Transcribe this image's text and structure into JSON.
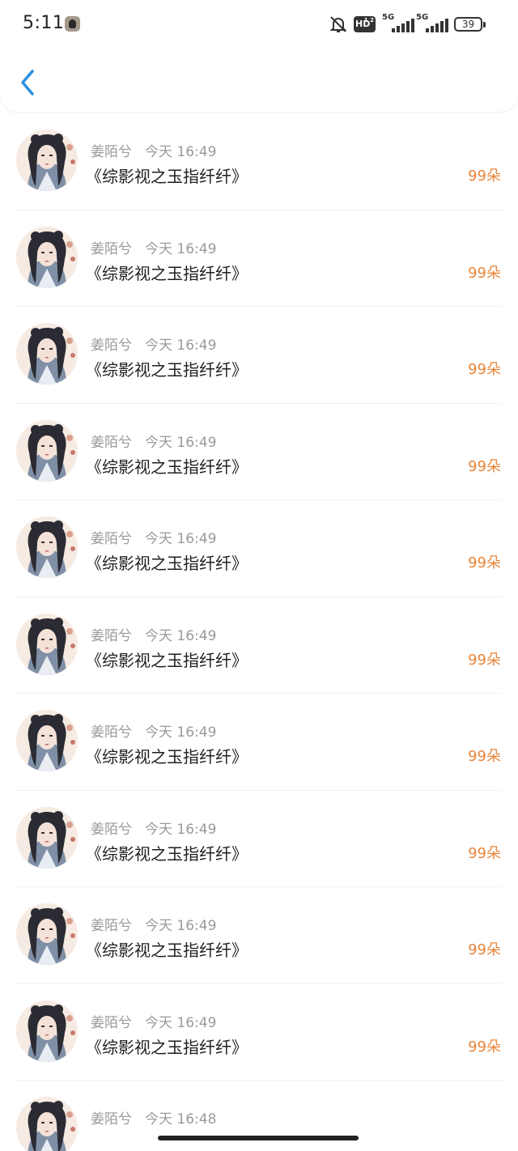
{
  "status_bar": {
    "time": "5:11",
    "network_hd": "HD",
    "network_hd_sub": "1 2",
    "sim1_label": "5G",
    "sim2_label": "5G",
    "battery": "39"
  },
  "header": {
    "back_icon": "chevron-left-icon",
    "accent": "#2b8fde"
  },
  "colors": {
    "amount": "#e8853a",
    "meta": "#9a9a9a",
    "title": "#1f1f1f"
  },
  "items": [
    {
      "name": "姜陌兮",
      "time": "今天 16:49",
      "title": "《综影视之玉指纤纤》",
      "amount": "99朵"
    },
    {
      "name": "姜陌兮",
      "time": "今天 16:49",
      "title": "《综影视之玉指纤纤》",
      "amount": "99朵"
    },
    {
      "name": "姜陌兮",
      "time": "今天 16:49",
      "title": "《综影视之玉指纤纤》",
      "amount": "99朵"
    },
    {
      "name": "姜陌兮",
      "time": "今天 16:49",
      "title": "《综影视之玉指纤纤》",
      "amount": "99朵"
    },
    {
      "name": "姜陌兮",
      "time": "今天 16:49",
      "title": "《综影视之玉指纤纤》",
      "amount": "99朵"
    },
    {
      "name": "姜陌兮",
      "time": "今天 16:49",
      "title": "《综影视之玉指纤纤》",
      "amount": "99朵"
    },
    {
      "name": "姜陌兮",
      "time": "今天 16:49",
      "title": "《综影视之玉指纤纤》",
      "amount": "99朵"
    },
    {
      "name": "姜陌兮",
      "time": "今天 16:49",
      "title": "《综影视之玉指纤纤》",
      "amount": "99朵"
    },
    {
      "name": "姜陌兮",
      "time": "今天 16:49",
      "title": "《综影视之玉指纤纤》",
      "amount": "99朵"
    },
    {
      "name": "姜陌兮",
      "time": "今天 16:49",
      "title": "《综影视之玉指纤纤》",
      "amount": "99朵"
    },
    {
      "name": "姜陌兮",
      "time": "今天 16:48",
      "title": "",
      "amount": ""
    }
  ]
}
